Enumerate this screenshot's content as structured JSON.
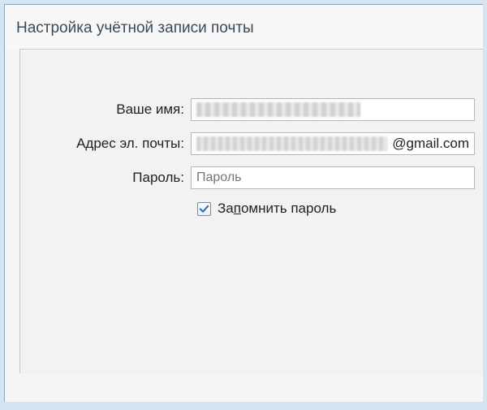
{
  "window": {
    "title": "Настройка учётной записи почты"
  },
  "form": {
    "name_label": "Ваше имя:",
    "email_label": "Адрес эл. почты:",
    "email_suffix": "@gmail.com",
    "password_label": "Пароль:",
    "password_placeholder": "Пароль",
    "remember_prefix": "За",
    "remember_underlined": "п",
    "remember_suffix": "омнить пароль",
    "remember_checked": true
  }
}
